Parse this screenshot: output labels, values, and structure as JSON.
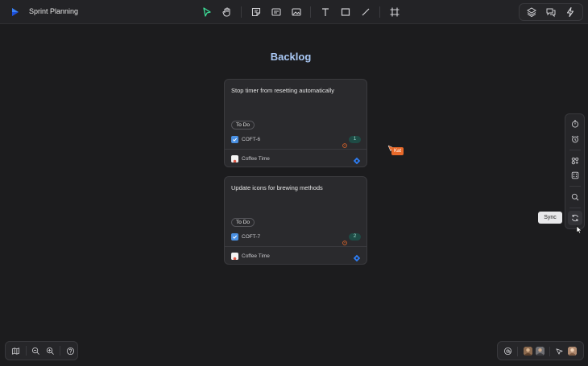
{
  "header": {
    "board_title": "Sprint Planning",
    "tools": [
      "select-icon",
      "hand-icon",
      "sticky-note-icon",
      "card-icon",
      "image-icon",
      "text-icon",
      "rectangle-icon",
      "line-icon",
      "frame-icon"
    ],
    "right_tools": [
      "layers-icon",
      "comments-icon",
      "lightning-icon"
    ]
  },
  "canvas": {
    "heading": "Backlog",
    "cards": [
      {
        "title": "Stop timer from resetting automatically",
        "status": "To Do",
        "issue_key": "COFT-6",
        "count": "1",
        "project": "Coffee Time"
      },
      {
        "title": "Update icons for brewing methods",
        "status": "To Do",
        "issue_key": "COFT-7",
        "count": "2",
        "project": "Coffee Time"
      }
    ],
    "collaborator_cursor": {
      "name": "Kat",
      "color": "#e8692a"
    }
  },
  "side_panel": {
    "items": [
      "timer-icon",
      "alarm-icon",
      "apps-icon",
      "dice-icon",
      "search-icon",
      "sync-icon"
    ],
    "tooltip": "Sync"
  },
  "bottom_left": {
    "items": [
      "map-icon",
      "zoom-out-icon",
      "zoom-in-icon",
      "help-icon"
    ]
  },
  "bottom_right": {
    "items": [
      "mention-icon",
      "avatar-1",
      "avatar-2",
      "present-icon",
      "avatar-me"
    ]
  },
  "colors": {
    "background": "#1c1c1e",
    "heading": "#a9c8f5",
    "accent_green": "#3ddc97",
    "jira_blue": "#2d7ff9"
  }
}
